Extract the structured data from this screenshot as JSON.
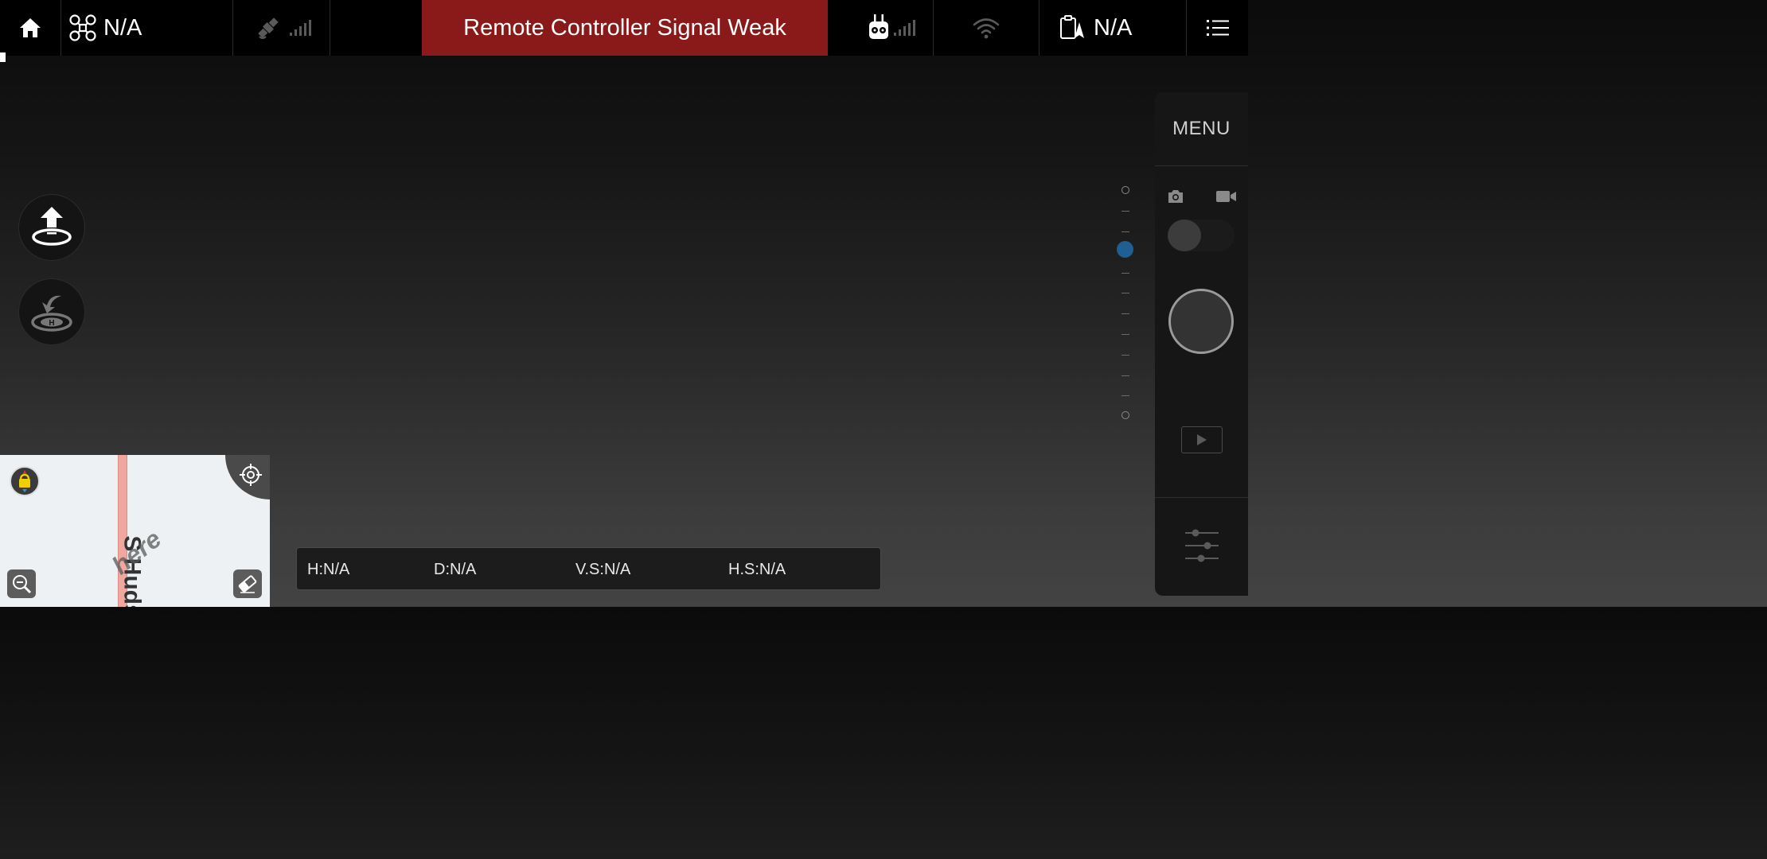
{
  "top_bar": {
    "aircraft_status": "N/A",
    "flight_mode": "N/A",
    "alert": "Remote Controller Signal Weak",
    "icons": {
      "home": "home-icon",
      "aircraft": "drone-icon",
      "satellite": "satellite-icon",
      "remote": "remote-controller-icon",
      "wifi": "wifi-icon",
      "checklist": "checklist-icon",
      "menu": "list-menu-icon"
    }
  },
  "left_controls": {
    "takeoff": "takeoff-icon",
    "return_home": "return-home-icon"
  },
  "map": {
    "street_label": "S Huds",
    "watermark": "here",
    "icons": [
      "compass-lock-icon",
      "recenter-icon",
      "zoom-out-icon",
      "eraser-icon"
    ]
  },
  "telemetry": {
    "height": "H:N/A",
    "distance": "D:N/A",
    "vertical_speed": "V.S:N/A",
    "horizontal_speed": "H.S:N/A"
  },
  "right_panel": {
    "menu_label": "MENU",
    "icons": [
      "camera-icon",
      "video-icon",
      "play-icon",
      "sliders-icon"
    ]
  },
  "colors": {
    "alert": "#8a1a1a",
    "knob": "#1f5f93"
  }
}
